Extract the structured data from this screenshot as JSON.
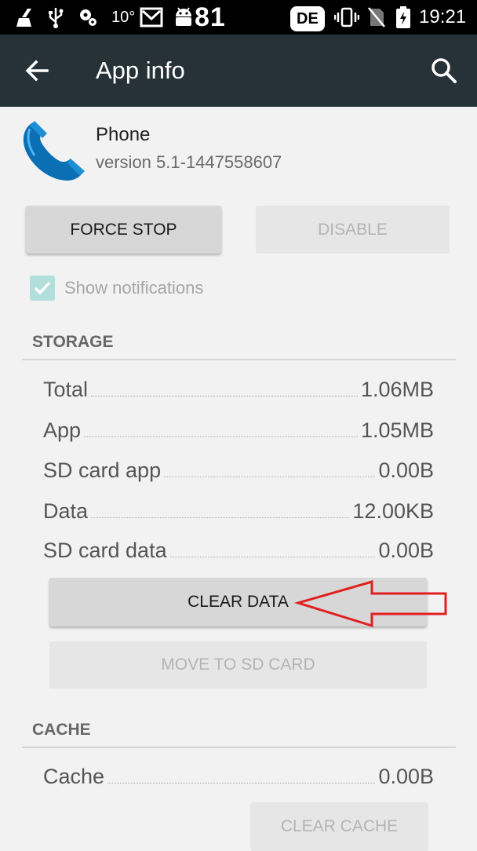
{
  "status_bar": {
    "temperature": "10°",
    "battery_level": "81",
    "keyboard_lang": "DE",
    "time": "19:21",
    "icons": [
      "broom-icon",
      "usb-icon",
      "settings-icon",
      "mail-icon",
      "android-icon",
      "vibrate-icon",
      "no-sim-icon",
      "battery-charging-icon"
    ]
  },
  "toolbar": {
    "title": "App info",
    "back_icon": "arrow-back-icon",
    "search_icon": "search-icon",
    "color": "#263238"
  },
  "app": {
    "name": "Phone",
    "version": "version 5.1-1447558607",
    "icon": "phone-icon"
  },
  "buttons": {
    "force_stop": "FORCE STOP",
    "disable": "DISABLE",
    "clear_data": "CLEAR DATA",
    "move_to_sd": "MOVE TO SD CARD",
    "clear_cache": "CLEAR CACHE"
  },
  "notifications": {
    "label": "Show notifications",
    "checked": true,
    "enabled": false
  },
  "storage": {
    "title": "STORAGE",
    "rows": [
      {
        "label": "Total",
        "value": "1.06MB"
      },
      {
        "label": "App",
        "value": "1.05MB"
      },
      {
        "label": "SD card app",
        "value": "0.00B"
      },
      {
        "label": "Data",
        "value": "12.00KB"
      },
      {
        "label": "SD card data",
        "value": "0.00B"
      }
    ]
  },
  "cache": {
    "title": "CACHE",
    "rows": [
      {
        "label": "Cache",
        "value": "0.00B"
      }
    ]
  },
  "annotation": {
    "arrow_color": "#e02020",
    "points_to": "CLEAR DATA"
  }
}
